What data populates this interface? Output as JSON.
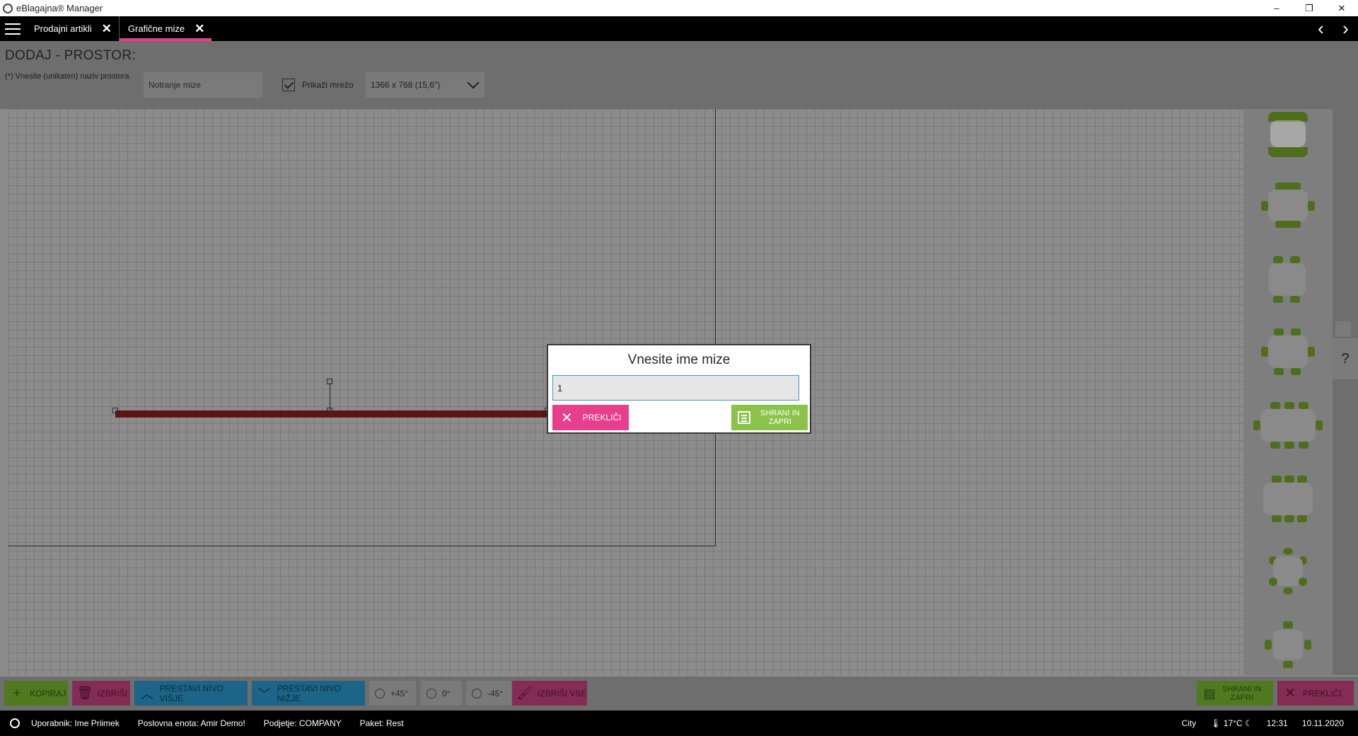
{
  "window": {
    "title": "eBlagajna® Manager",
    "minimize": "–",
    "restore": "❐",
    "close": "✕"
  },
  "tabs": [
    {
      "label": "Prodajni artikli",
      "close": "✕"
    },
    {
      "label": "Grafične mize",
      "close": "✕"
    }
  ],
  "nav": {
    "back": "‹",
    "forward": "›"
  },
  "header": {
    "title": "DODAJ - PROSTOR:",
    "name_label": "(*) Vnesite (unikaten) naziv prostora",
    "name_value": "Notranje mize",
    "show_grid_label": "Prikaži mrežo",
    "resolution": "1366 x 768 (15,6\")"
  },
  "help": {
    "label": "?"
  },
  "toolbar": {
    "copy": "KOPIRAJ",
    "delete": "IZBRIŠI",
    "level_up": "PRESTAVI NIVO VIŠJE",
    "level_down": "PRESTAVI NIVO NIŽJE",
    "rot_plus45": "+45°",
    "rot_0": "0°",
    "rot_minus45": "-45°",
    "delete_all": "IZBRIŠI VSE",
    "save_close_line1": "SHRANI IN",
    "save_close_line2": "ZAPRI",
    "cancel": "PREKLIČI"
  },
  "status": {
    "user": "Uporabnik: Ime Priimek",
    "unit": "Poslovna enota: Amir Demo!",
    "company": "Podjetje: COMPANY",
    "package": "Paket: Rest",
    "city": "City",
    "temp": "17°C",
    "time": "12:31",
    "date": "10.11.2020"
  },
  "modal": {
    "title": "Vnesite ime mize",
    "input_value": "1",
    "cancel": "PREKLIČI",
    "save_line1": "SHRANI IN",
    "save_line2": "ZAPRI"
  },
  "colors": {
    "accent_pink": "#e83e8c",
    "accent_green": "#8bc34a",
    "accent_blue": "#2196c8",
    "wall": "#5c1414"
  }
}
